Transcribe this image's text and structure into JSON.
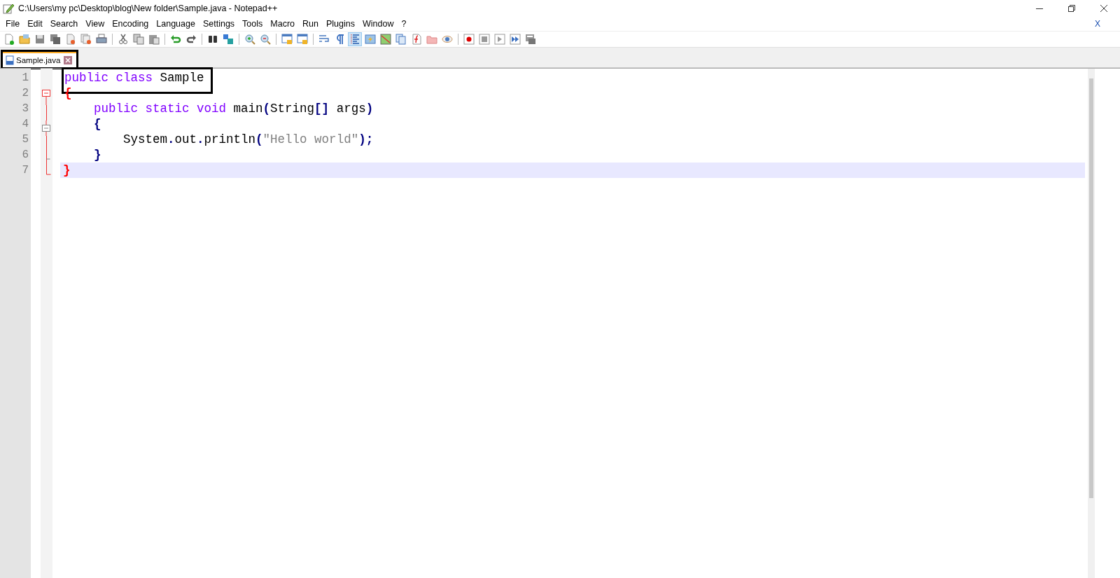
{
  "window": {
    "title": "C:\\Users\\my pc\\Desktop\\blog\\New folder\\Sample.java - Notepad++"
  },
  "menu": [
    "File",
    "Edit",
    "Search",
    "View",
    "Encoding",
    "Language",
    "Settings",
    "Tools",
    "Macro",
    "Run",
    "Plugins",
    "Window",
    "?"
  ],
  "menu_close": "X",
  "toolbar": [
    {
      "pressed": false
    },
    {
      "pressed": false
    },
    {
      "pressed": false
    },
    {
      "pressed": false
    },
    {
      "pressed": false
    },
    {
      "pressed": false
    },
    {
      "pressed": false
    },
    {
      "pressed": false
    },
    {
      "pressed": false
    },
    {
      "pressed": false
    },
    {
      "pressed": false
    },
    {
      "pressed": false
    },
    {
      "pressed": false
    },
    {
      "pressed": false
    },
    {
      "pressed": false
    },
    {
      "pressed": false
    },
    {
      "pressed": false
    },
    {
      "pressed": false
    },
    {
      "pressed": false
    },
    {
      "pressed": false
    },
    {
      "pressed": true
    },
    {
      "pressed": false
    },
    {
      "pressed": false
    },
    {
      "pressed": false
    },
    {
      "pressed": false
    },
    {
      "pressed": false
    },
    {
      "pressed": false
    },
    {
      "pressed": false
    },
    {
      "pressed": false
    },
    {
      "pressed": false
    },
    {
      "pressed": false
    },
    {
      "pressed": false
    }
  ],
  "tabs": [
    {
      "label": "Sample.java",
      "selected": true,
      "outlined": true
    }
  ],
  "editor": {
    "lines": [
      {
        "number": "1",
        "current": false,
        "outlined": true,
        "kind": "plain",
        "tokens": [
          {
            "text": "public",
            "kind": "keyword"
          },
          {
            "text": " class",
            "kind": "keyword"
          },
          {
            "text": " Sample",
            "kind": "plain"
          }
        ]
      },
      {
        "number": "2",
        "current": false,
        "outlined": false,
        "kind": "fold-open",
        "tokens": [
          {
            "text": "{",
            "kind": "brace"
          }
        ]
      },
      {
        "number": "3",
        "current": false,
        "outlined": false,
        "kind": "fold-body",
        "tokens": [
          {
            "text": "    public",
            "kind": "keyword"
          },
          {
            "text": " static",
            "kind": "keyword"
          },
          {
            "text": " void",
            "kind": "keyword"
          },
          {
            "text": " main",
            "kind": "plain"
          },
          {
            "text": "(",
            "kind": "operator"
          },
          {
            "text": "String",
            "kind": "plain"
          },
          {
            "text": "[]",
            "kind": "operator"
          },
          {
            "text": " args",
            "kind": "plain"
          },
          {
            "text": ")",
            "kind": "operator"
          }
        ]
      },
      {
        "number": "4",
        "current": false,
        "outlined": false,
        "kind": "subfold-open",
        "tokens": [
          {
            "text": "    {",
            "kind": "operator"
          }
        ]
      },
      {
        "number": "5",
        "current": false,
        "outlined": false,
        "kind": "fold-body",
        "tokens": [
          {
            "text": "        System",
            "kind": "plain"
          },
          {
            "text": ".",
            "kind": "operator"
          },
          {
            "text": "out",
            "kind": "plain"
          },
          {
            "text": ".",
            "kind": "operator"
          },
          {
            "text": "println",
            "kind": "plain"
          },
          {
            "text": "(",
            "kind": "operator"
          },
          {
            "text": "\"Hello world\"",
            "kind": "string"
          },
          {
            "text": ");",
            "kind": "operator"
          }
        ]
      },
      {
        "number": "6",
        "current": false,
        "outlined": false,
        "kind": "subfold-end",
        "tokens": [
          {
            "text": "    }",
            "kind": "operator"
          }
        ]
      },
      {
        "number": "7",
        "current": true,
        "outlined": false,
        "kind": "fold-end",
        "tokens": [
          {
            "text": "}",
            "kind": "brace"
          }
        ]
      }
    ]
  }
}
